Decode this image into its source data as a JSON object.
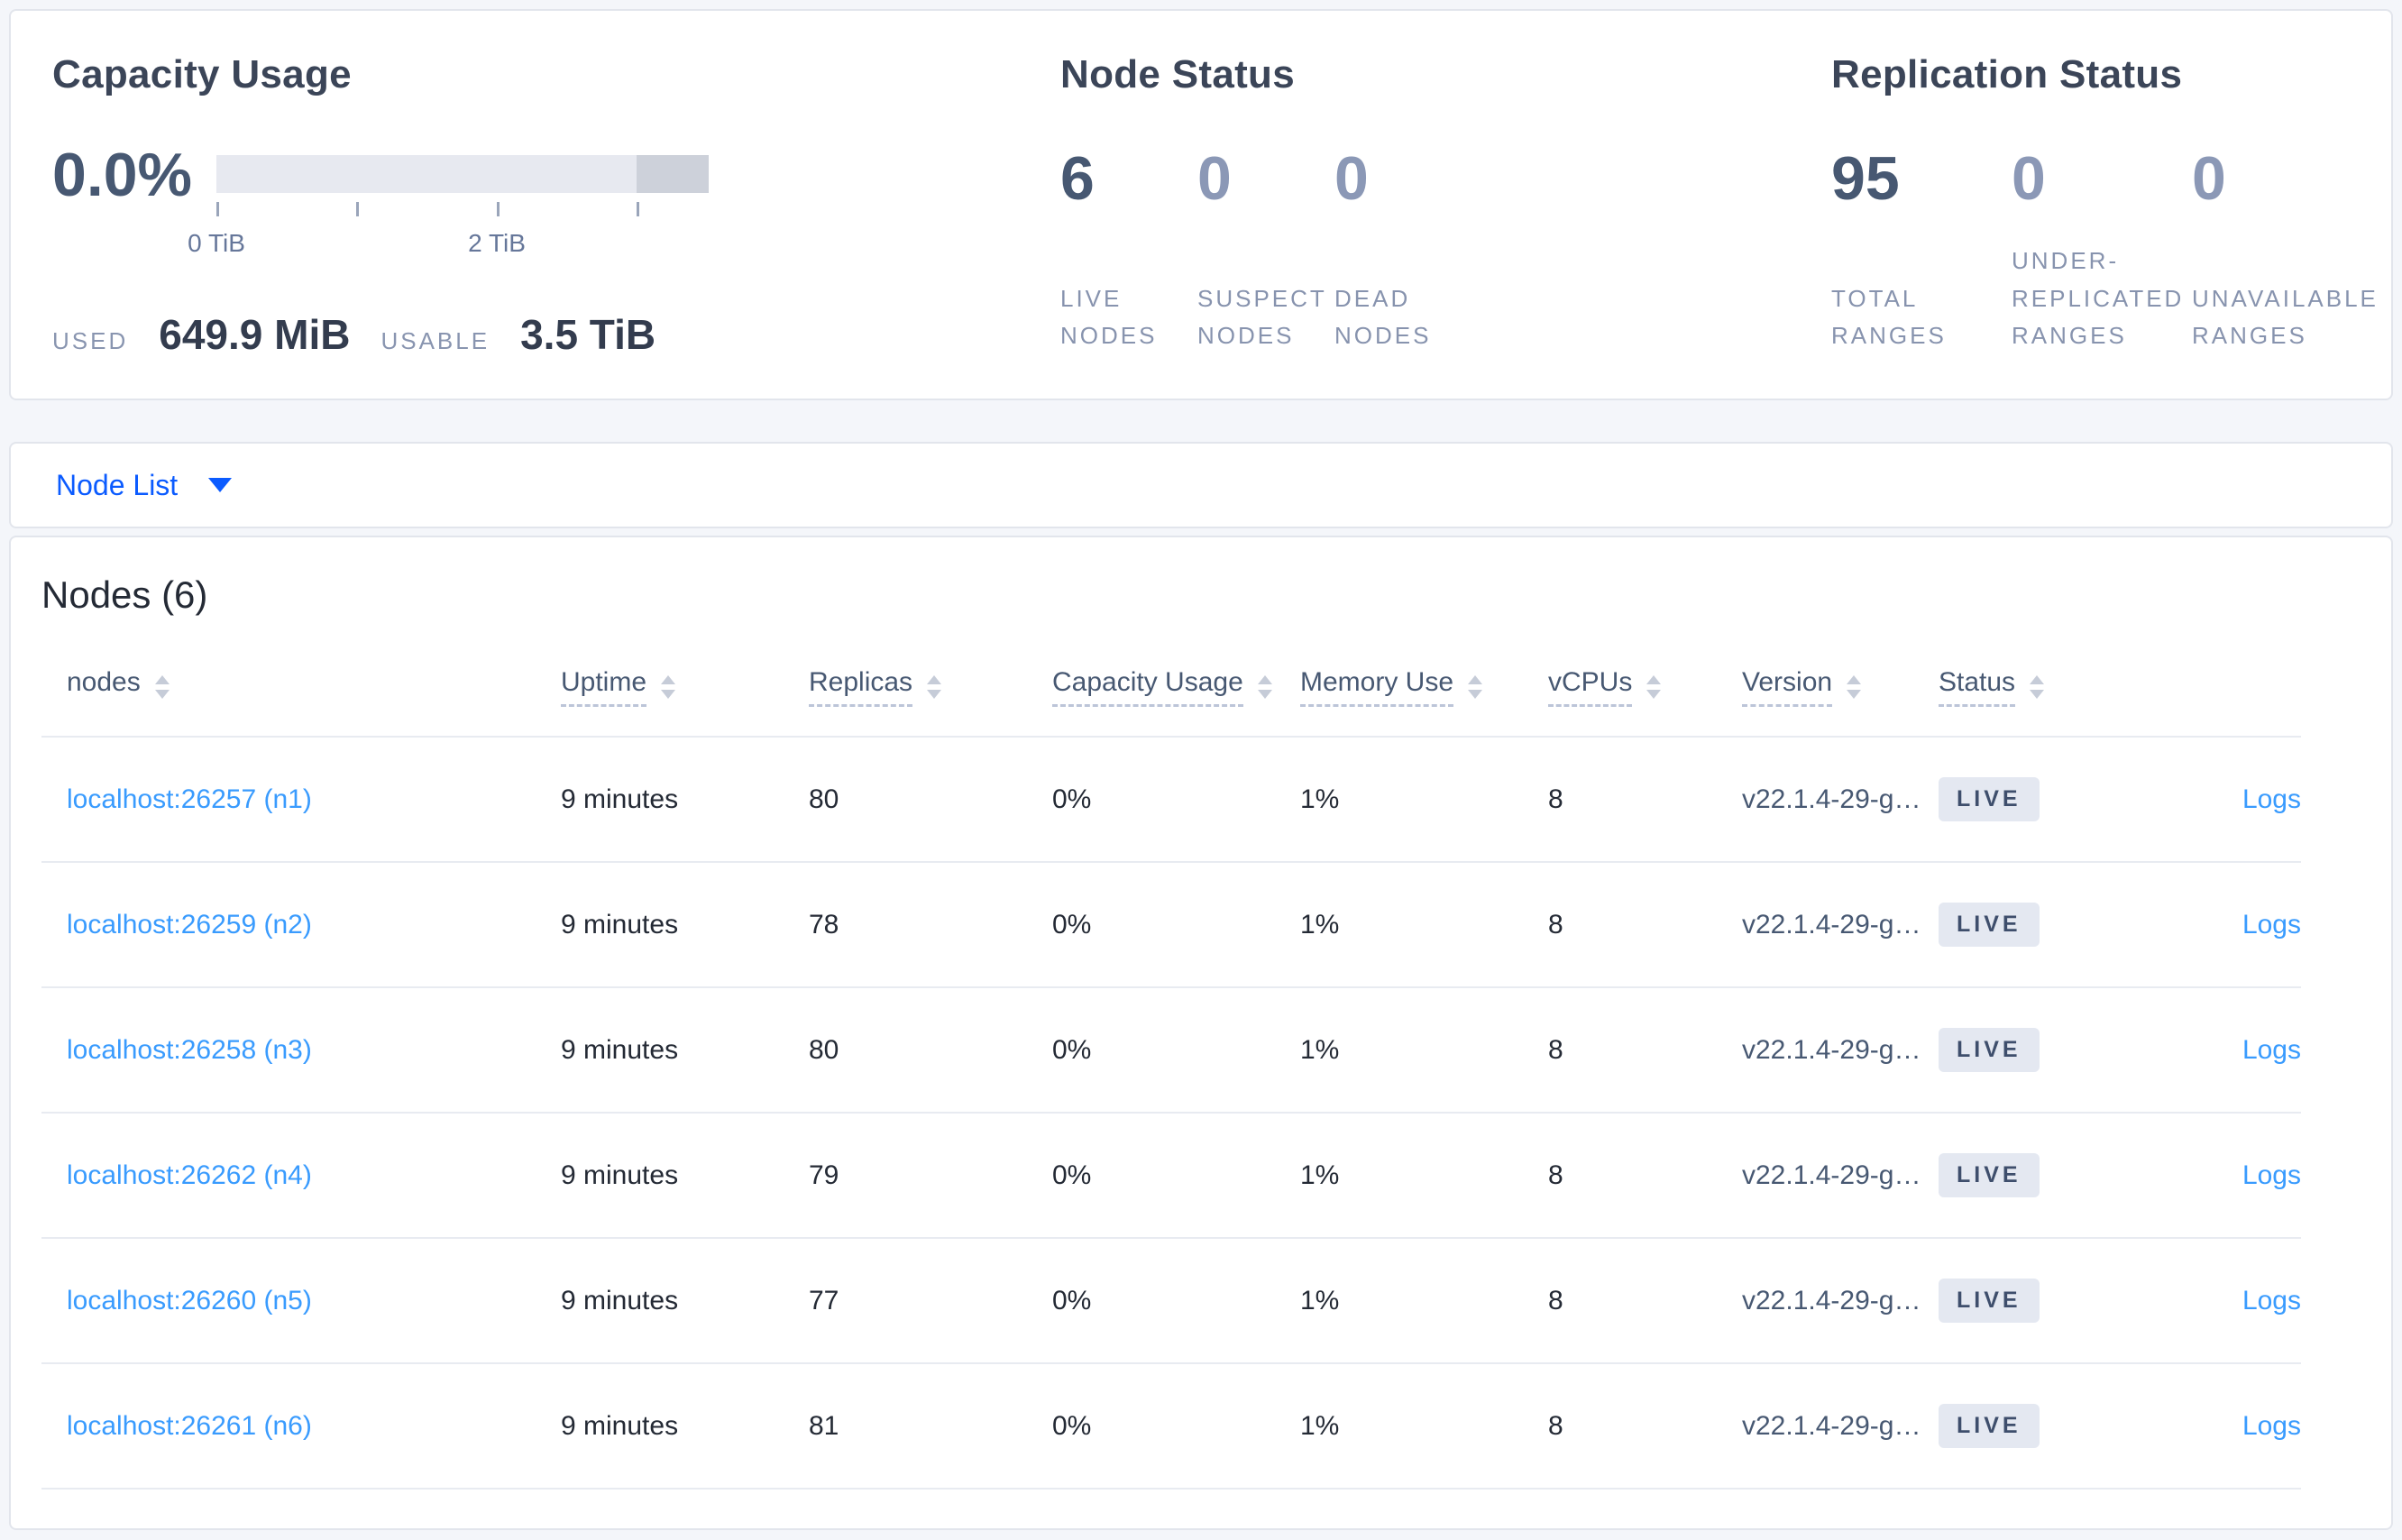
{
  "summary": {
    "capacity": {
      "title": "Capacity Usage",
      "percent": "0.0%",
      "axis_tick_labels": [
        "0 TiB",
        "2 TiB"
      ],
      "used_label": "USED",
      "used_value": "649.9 MiB",
      "usable_label": "USABLE",
      "usable_value": "3.5 TiB"
    },
    "node_status": {
      "title": "Node Status",
      "stats": [
        {
          "value": "6",
          "label": "LIVE NODES"
        },
        {
          "value": "0",
          "label": "SUSPECT NODES"
        },
        {
          "value": "0",
          "label": "DEAD NODES"
        }
      ]
    },
    "replication_status": {
      "title": "Replication Status",
      "stats": [
        {
          "value": "95",
          "label": "TOTAL RANGES"
        },
        {
          "value": "0",
          "label": "UNDER-REPLICATED RANGES"
        },
        {
          "value": "0",
          "label": "UNAVAILABLE RANGES"
        }
      ]
    }
  },
  "view_selector": {
    "label": "Node List"
  },
  "nodes_section": {
    "title": "Nodes (6)",
    "logs_label": "Logs",
    "columns": [
      {
        "label": "nodes"
      },
      {
        "label": "Uptime"
      },
      {
        "label": "Replicas"
      },
      {
        "label": "Capacity Usage"
      },
      {
        "label": "Memory Use"
      },
      {
        "label": "vCPUs"
      },
      {
        "label": "Version"
      },
      {
        "label": "Status"
      }
    ],
    "rows": [
      {
        "address": "localhost:26257 (n1)",
        "uptime": "9 minutes",
        "replicas": "80",
        "capacity_usage": "0%",
        "memory_use": "1%",
        "vcpus": "8",
        "version": "v22.1.4-29-g…",
        "status": "LIVE"
      },
      {
        "address": "localhost:26259 (n2)",
        "uptime": "9 minutes",
        "replicas": "78",
        "capacity_usage": "0%",
        "memory_use": "1%",
        "vcpus": "8",
        "version": "v22.1.4-29-g…",
        "status": "LIVE"
      },
      {
        "address": "localhost:26258 (n3)",
        "uptime": "9 minutes",
        "replicas": "80",
        "capacity_usage": "0%",
        "memory_use": "1%",
        "vcpus": "8",
        "version": "v22.1.4-29-g…",
        "status": "LIVE"
      },
      {
        "address": "localhost:26262 (n4)",
        "uptime": "9 minutes",
        "replicas": "79",
        "capacity_usage": "0%",
        "memory_use": "1%",
        "vcpus": "8",
        "version": "v22.1.4-29-g…",
        "status": "LIVE"
      },
      {
        "address": "localhost:26260 (n5)",
        "uptime": "9 minutes",
        "replicas": "77",
        "capacity_usage": "0%",
        "memory_use": "1%",
        "vcpus": "8",
        "version": "v22.1.4-29-g…",
        "status": "LIVE"
      },
      {
        "address": "localhost:26261 (n6)",
        "uptime": "9 minutes",
        "replicas": "81",
        "capacity_usage": "0%",
        "memory_use": "1%",
        "vcpus": "8",
        "version": "v22.1.4-29-g…",
        "status": "LIVE"
      }
    ]
  },
  "colors": {
    "accent_blue": "#0b5bff",
    "link_blue": "#399bfe",
    "badge_bg": "#e4e8f1",
    "badge_text": "#3e4e6c",
    "capacity_bar_light": "#e7e9f0",
    "capacity_bar_dark": "#cdd1da",
    "page_background": "#f4f6fa"
  }
}
